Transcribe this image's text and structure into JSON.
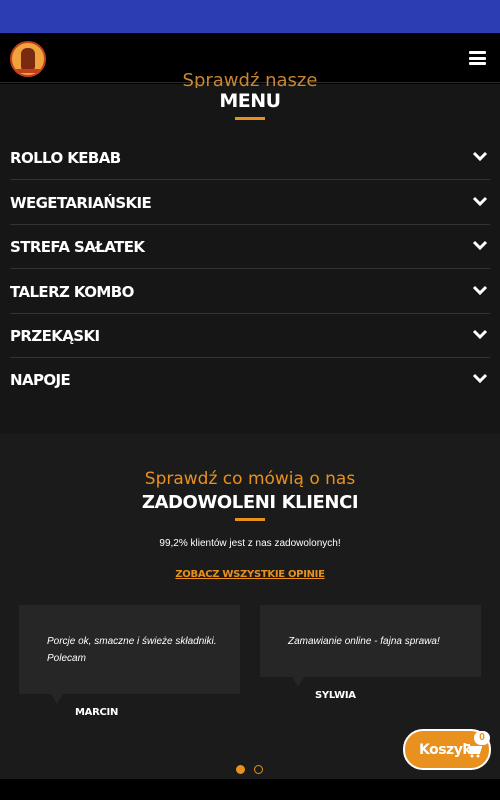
{
  "header": {
    "logo_icon": "kebab-logo-icon",
    "menu_icon": "hamburger-icon"
  },
  "menu": {
    "subtitle": "Sprawdź nasze",
    "title": "MENU",
    "categories": [
      {
        "label": "ROLLO KEBAB"
      },
      {
        "label": "WEGETARIAŃSKIE"
      },
      {
        "label": "STREFA SAŁATEK"
      },
      {
        "label": "TALERZ KOMBO"
      },
      {
        "label": "PRZEKĄSKI"
      },
      {
        "label": "NAPOJE"
      }
    ]
  },
  "reviews": {
    "kicker": "Sprawdź co mówią o nas",
    "title": "ZADOWOLENI KLIENCI",
    "stat": "99,2% klientów jest z nas zadowolonych!",
    "link": "ZOBACZ WSZYSTKIE OPINIE",
    "items": [
      {
        "quote_line1": "Porcje ok, smaczne i świeże składniki.",
        "quote_line2": "Polecam",
        "author": "MARCIN"
      },
      {
        "quote_line1": "Zamawianie online - fajna sprawa!",
        "quote_line2": "",
        "author": "SYLWIA"
      }
    ],
    "pagination": {
      "current": 1,
      "total": 2
    }
  },
  "cart": {
    "label": "Koszyk",
    "count": "0",
    "icon": "cart-icon"
  },
  "colors": {
    "accent": "#e8911e",
    "topbar": "#2c3cb2",
    "background": "#000000",
    "section": "#161616",
    "card": "#262626"
  }
}
